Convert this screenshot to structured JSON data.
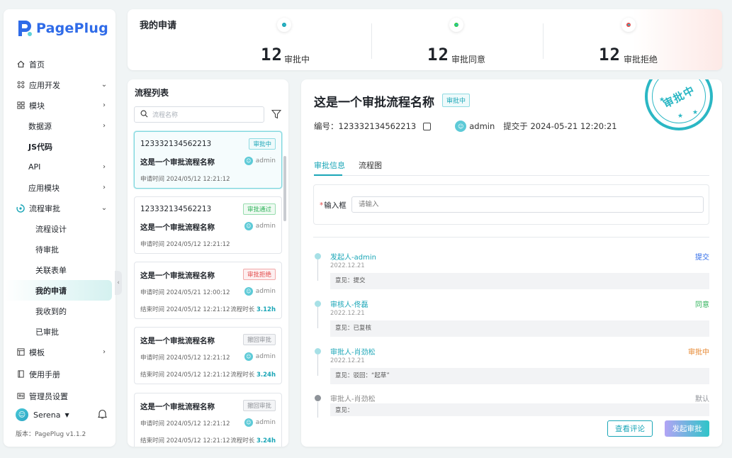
{
  "app": {
    "logo_text": "PagePlug",
    "logo_letter": "P",
    "version": "版本：PagePlug v1.1.2"
  },
  "sidebar": {
    "items": [
      {
        "label": "首页",
        "icon": "home-icon"
      },
      {
        "label": "应用开发",
        "icon": "grid-icon"
      },
      {
        "label": "模块",
        "icon": "module-icon"
      },
      {
        "label": "数据源"
      },
      {
        "label": "JS代码"
      },
      {
        "label": "API"
      },
      {
        "label": "应用模块"
      },
      {
        "label": "流程审批",
        "icon": "process-icon"
      },
      {
        "label": "流程设计"
      },
      {
        "label": "待审批"
      },
      {
        "label": "关联表单"
      },
      {
        "label": "我的申请"
      },
      {
        "label": "我收到的"
      },
      {
        "label": "已审批"
      },
      {
        "label": "模板",
        "icon": "template-icon"
      },
      {
        "label": "使用手册",
        "icon": "manual-icon"
      },
      {
        "label": "管理员设置",
        "icon": "admin-icon"
      }
    ],
    "user": {
      "name": "Serena"
    }
  },
  "stats": {
    "title": "我的申请",
    "items": [
      {
        "value": "12",
        "label": "审批中",
        "color": "#1aa6b7"
      },
      {
        "value": "12",
        "label": "审批同意",
        "color": "#2fb35a"
      },
      {
        "value": "12",
        "label": "审批拒绝",
        "color": "#e34d4d"
      }
    ]
  },
  "flowlist": {
    "title": "流程列表",
    "search_placeholder": "流程名称",
    "cards": [
      {
        "id": "123332134562213",
        "name": "这是一个审批流程名称",
        "status": "审批中",
        "owner": "admin",
        "apply_time": "申请时间 2024/05/12 12:21:12"
      },
      {
        "id": "123332134562213",
        "name": "这是一个审批流程名称",
        "status": "审批通过",
        "owner": "admin",
        "apply_time": "申请时间 2024/05/12 12:21:12"
      },
      {
        "name": "这是一个审批流程名称",
        "status": "审批拒绝",
        "owner": "admin",
        "apply_time": "申请时间 2024/05/21 12:00:12",
        "end_time": "结束时间 2024/05/12 12:21:12",
        "duration_label": "流程时长",
        "duration": "3.12h"
      },
      {
        "name": "这是一个审批流程名称",
        "status": "撤回审批",
        "owner": "admin",
        "apply_time": "申请时间 2024/05/12 12:21:12",
        "end_time": "结束时间 2024/05/12 12:21:12",
        "duration_label": "流程时长",
        "duration": "3.24h"
      },
      {
        "name": "这是一个审批流程名称",
        "status": "撤回审批",
        "owner": "admin",
        "apply_time": "申请时间 2024/05/12 12:21:12",
        "end_time": "结束时间 2024/05/12 12:21:12",
        "duration_label": "流程时长",
        "duration": "3.24h"
      }
    ]
  },
  "detail": {
    "title": "这是一个审批流程名称",
    "badge": "审批中",
    "stamp": "审批中",
    "number": "编号：123332134562213",
    "owner": "admin",
    "submitted": "提交于 2024-05-21 12:20:21",
    "tabs": [
      "审批信息",
      "流程图"
    ],
    "form_label": "输入框",
    "form_placeholder": "请输入",
    "timeline": [
      {
        "name": "发起人-admin",
        "date": "2022.12.21",
        "opinion": "意见：提交",
        "status": "提交",
        "status_color": "#2f6be8"
      },
      {
        "name": "审核人-佟磊",
        "date": "2022.12.21",
        "opinion": "意见：已复核",
        "status": "同意",
        "status_color": "#2fb35a"
      },
      {
        "name": "审批人-肖劲松",
        "date": "2022.12.21",
        "opinion": "意见：驳回：“起草”",
        "status": "审批中",
        "status_color": "#e6862e"
      },
      {
        "name": "审批人-肖劲松",
        "date": "",
        "opinion": "意见：",
        "status": "默认",
        "status_color": "#909399"
      }
    ],
    "btn_review": "查看评论",
    "btn_submit": "发起审批"
  }
}
